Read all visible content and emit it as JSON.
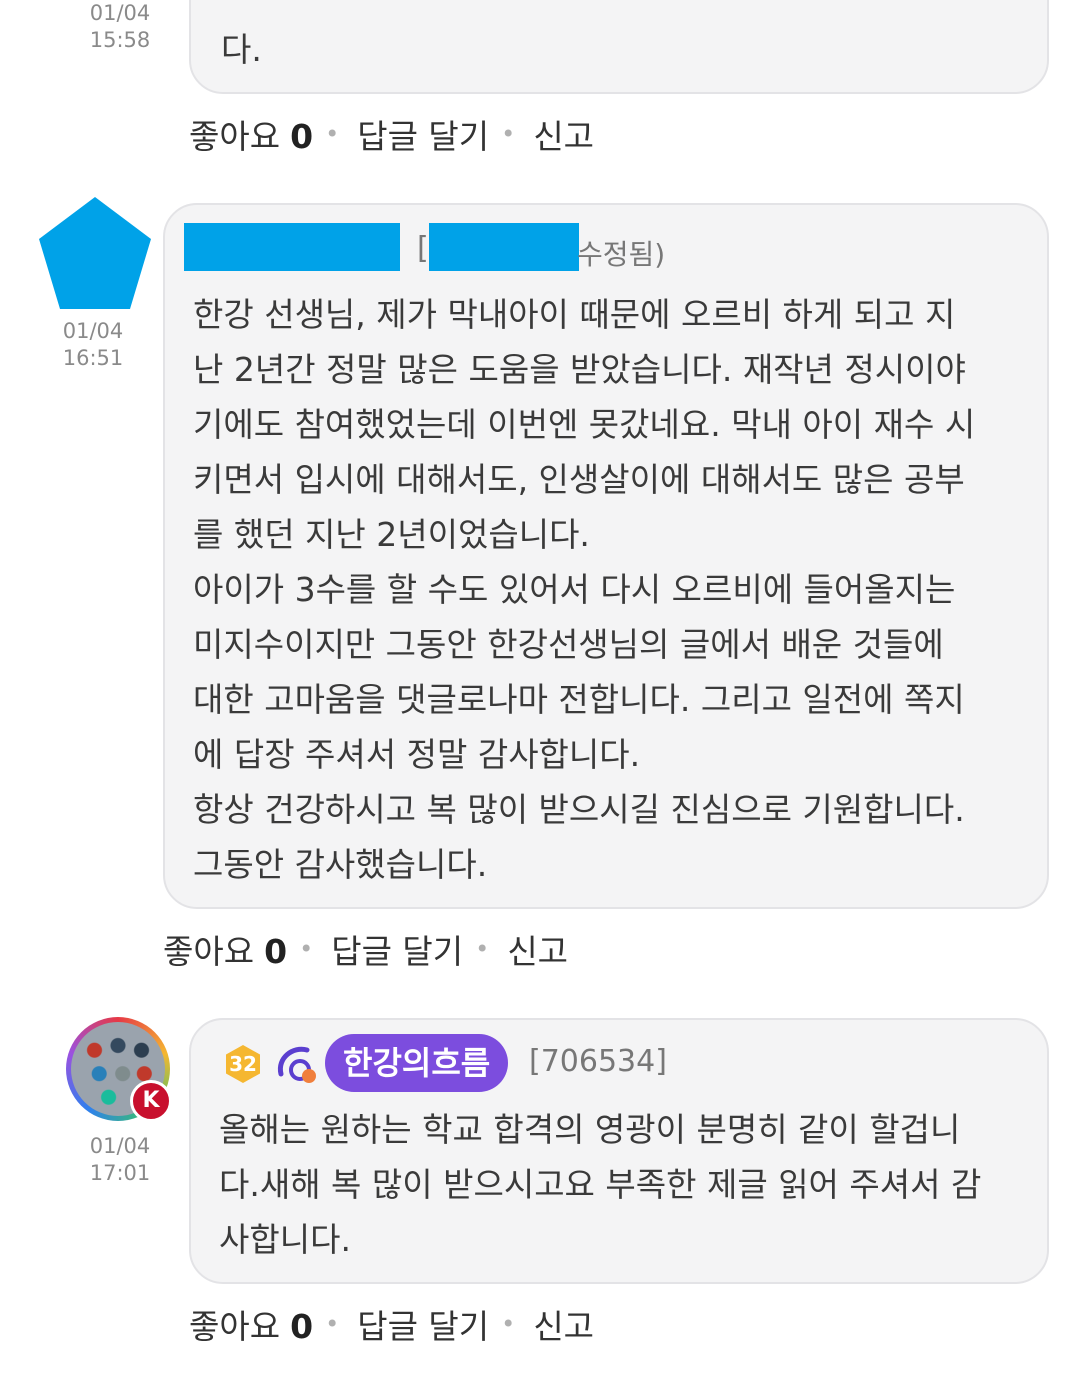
{
  "comments": [
    {
      "time_date": "01/04",
      "time_clock": "15:58",
      "body": "다.",
      "actions": {
        "like_label": "좋아요",
        "like_count": "0",
        "reply_label": "답글 달기",
        "report_label": "신고"
      }
    },
    {
      "time_date": "01/04",
      "time_clock": "16:51",
      "header_open": "[",
      "header_edited": "수정됨)",
      "body": "한강 선생님, 제가 막내아이 때문에 오르비 하게 되고 지\n난 2년간 정말 많은 도움을 받았습니다. 재작년 정시이야\n기에도 참여했었는데 이번엔 못갔네요. 막내 아이 재수 시\n키면서 입시에 대해서도, 인생살이에 대해서도 많은 공부\n를 했던 지난 2년이었습니다.\n아이가 3수를 할 수도 있어서 다시 오르비에 들어올지는\n미지수이지만 그동안 한강선생님의 글에서 배운 것들에\n대한 고마움을 댓글로나마 전합니다. 그리고 일전에 쪽지\n에 답장 주셔서 정말 감사합니다.\n항상 건강하시고 복 많이 받으시길 진심으로 기원합니다.\n그동안 감사했습니다.",
      "actions": {
        "like_label": "좋아요",
        "like_count": "0",
        "reply_label": "답글 달기",
        "report_label": "신고"
      }
    },
    {
      "time_date": "01/04",
      "time_clock": "17:01",
      "level": "32",
      "avatar_badge": "K",
      "author": "한강의흐름",
      "user_id": "[706534]",
      "body": "올해는 원하는 학교 합격의 영광이 분명히 같이 할겁니\n다.새해 복 많이 받으시고요 부족한 제글 읽어 주셔서 감\n사합니다.",
      "actions": {
        "like_label": "좋아요",
        "like_count": "0",
        "reply_label": "답글 달기",
        "report_label": "신고"
      }
    }
  ],
  "colors": {
    "redaction": "#00a2e8",
    "author_pill": "#7c4dde",
    "level_badge": "#f5b731",
    "bubble": "#f4f4f5"
  }
}
